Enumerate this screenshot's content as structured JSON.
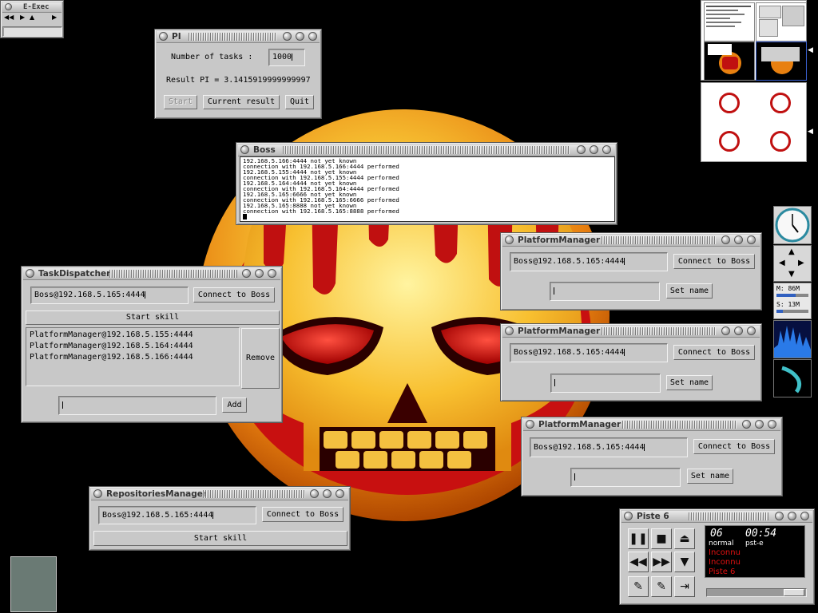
{
  "eexec": {
    "title": "E-Exec"
  },
  "pi": {
    "title": "PI",
    "tasks_label": "Number of tasks :",
    "tasks_value": "1000",
    "result_text": "Result PI = 3.1415919999999997",
    "start_label": "Start",
    "current_result_label": "Current result",
    "quit_label": "Quit"
  },
  "boss": {
    "title": "Boss",
    "log": [
      "192.168.5.166:4444 not yet known",
      "connection with 192.168.5.166:4444 performed",
      "192.168.5.155:4444 not yet known",
      "connection with 192.168.5.155:4444 performed",
      "192.168.5.164:4444 not yet known",
      "connection with 192.168.5.164:4444 performed",
      "192.168.5.165:6666 not yet known",
      "connection with 192.168.5.165:6666 performed",
      "192.168.5.165:8888 not yet known",
      "connection with 192.168.5.165:8888 performed"
    ]
  },
  "task_dispatcher": {
    "title": "TaskDispatcher",
    "boss_address": "Boss@192.168.5.165:4444",
    "connect_label": "Connect to Boss",
    "start_skill_label": "Start skill",
    "list": [
      "PlatformManager@192.168.5.155:4444",
      "PlatformManager@192.168.5.164:4444",
      "PlatformManager@192.168.5.166:4444"
    ],
    "remove_label": "Remove",
    "add_label": "Add",
    "add_value": ""
  },
  "platform_managers": [
    {
      "title": "PlatformManager",
      "boss_address": "Boss@192.168.5.165:4444",
      "connect_label": "Connect to Boss",
      "set_name_label": "Set name",
      "name_value": ""
    },
    {
      "title": "PlatformManager",
      "boss_address": "Boss@192.168.5.165:4444",
      "connect_label": "Connect to Boss",
      "set_name_label": "Set name",
      "name_value": ""
    },
    {
      "title": "PlatformManager",
      "boss_address": "Boss@192.168.5.165:4444",
      "connect_label": "Connect to Boss",
      "set_name_label": "Set name",
      "name_value": ""
    }
  ],
  "repositories_manager": {
    "title": "RepositoriesManager",
    "boss_address": "Boss@192.168.5.165:4444",
    "connect_label": "Connect to Boss",
    "start_skill_label": "Start skill"
  },
  "memory": {
    "mem_label": "M: 86M",
    "swap_label": "S: 13M",
    "mem_fraction": 0.6,
    "swap_fraction": 0.2
  },
  "piste": {
    "title": "Piste 6",
    "track_number": "06",
    "time": "00:54",
    "mode": "normal",
    "mode2": "pst-e",
    "artist": "Inconnu",
    "album": "Inconnu",
    "track_name": "Piste 6"
  },
  "colors": {
    "window_bg": "#c8c8c8",
    "desktop_bg": "#000000",
    "skull_orange": "#f0a020",
    "player_red": "#e01010"
  }
}
